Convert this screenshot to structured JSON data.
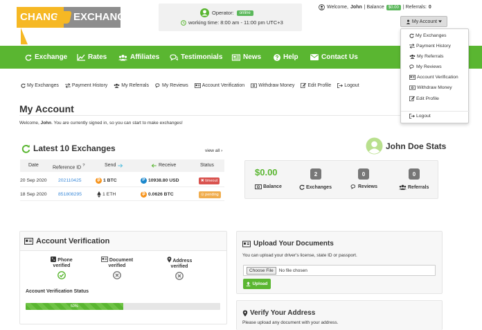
{
  "header": {
    "logo_left": "CHANGE",
    "logo_right": "EXCHANGE",
    "operator_label": "Operator:",
    "operator_status": "online",
    "working_time": "working time: 8:00 am - 11:00 pm UTC+3",
    "welcome_prefix": "Welcome,",
    "user_name": "John",
    "balance_label": "| Balance",
    "balance_value": "$0.00",
    "referrals_label": "| Referrals:",
    "referrals_value": "0",
    "account_button": "My Account"
  },
  "nav": {
    "items": [
      {
        "label": "Exchange",
        "icon": "refresh-icon"
      },
      {
        "label": "Rates",
        "icon": "chart-icon"
      },
      {
        "label": "Affiliates",
        "icon": "users-icon"
      },
      {
        "label": "Testimonials",
        "icon": "comments-icon"
      },
      {
        "label": "News",
        "icon": "newspaper-icon"
      },
      {
        "label": "Help",
        "icon": "question-icon"
      },
      {
        "label": "Contact Us",
        "icon": "envelope-icon"
      }
    ]
  },
  "subnav": {
    "items": [
      {
        "label": "My Exchanges",
        "icon": "refresh-icon"
      },
      {
        "label": "Payment History",
        "icon": "arrows-icon"
      },
      {
        "label": "My Referrals",
        "icon": "users-icon"
      },
      {
        "label": "My Reviews",
        "icon": "comments-icon"
      },
      {
        "label": "Account Verification",
        "icon": "id-card-icon"
      },
      {
        "label": "Withdraw Money",
        "icon": "money-icon"
      },
      {
        "label": "Edit Profile",
        "icon": "edit-icon"
      },
      {
        "label": "Logout",
        "icon": "logout-icon"
      }
    ]
  },
  "dropdown": {
    "items": [
      {
        "label": "My Exchanges",
        "icon": "refresh-icon"
      },
      {
        "label": "Payment History",
        "icon": "arrows-icon"
      },
      {
        "label": "My Referrals",
        "icon": "users-icon"
      },
      {
        "label": "My Reviews",
        "icon": "comments-icon"
      },
      {
        "label": "Account Verification",
        "icon": "id-card-icon"
      },
      {
        "label": "Withdraw Money",
        "icon": "money-icon"
      },
      {
        "label": "Edit Profile",
        "icon": "edit-icon"
      }
    ],
    "logout": "Logout"
  },
  "page": {
    "title": "My Account",
    "welcome_pre": "Welcome,",
    "welcome_name": "John",
    "welcome_post": ". You are currently signed in, so you can start to make exchanges!"
  },
  "exchanges": {
    "title": "Latest 10 Exchanges",
    "view_all": "view all ›",
    "columns": [
      "Date",
      "Reference ID",
      "Send",
      "Receive",
      "Status"
    ],
    "ref_sup": "?",
    "rows": [
      {
        "date": "20 Sep 2020",
        "ref": "202110425",
        "send": "1 BTC",
        "send_coin": "btc",
        "receive": "10938.80 USD",
        "receive_coin": "paypal",
        "status": "timeout",
        "status_color": "#d9534f"
      },
      {
        "date": "18 Sep 2020",
        "ref": "851808295",
        "send": "1 ETH",
        "send_coin": "eth",
        "receive": "0.0626 BTC",
        "receive_coin": "btc",
        "status": "pending",
        "status_color": "#f0ad4e"
      }
    ]
  },
  "stats": {
    "title": "John Doe Stats",
    "balance_value": "$0.00",
    "balance_label": "Balance",
    "exchanges_value": "2",
    "exchanges_label": "Exchanges",
    "reviews_value": "0",
    "reviews_label": "Reviews",
    "referrals_value": "0",
    "referrals_label": "Referrals"
  },
  "verification": {
    "title": "Account Verification",
    "phone_label": "Phone",
    "phone_status": "verified",
    "document_label": "Document",
    "document_status": "verified",
    "address_label": "Address",
    "address_status": "verified",
    "status_label": "Account Verification Status",
    "progress_text": "50%",
    "progress_percent": 50
  },
  "upload": {
    "title": "Upload Your Documents",
    "description": "You can upload your driver's license, state ID or passport.",
    "choose_file": "Choose File",
    "no_file": "No file chosen",
    "upload_button": "Upload"
  },
  "verify_address": {
    "title": "Verify Your Address",
    "description": "Please upload any document with your address."
  },
  "colors": {
    "green": "#5ab631",
    "orange": "#f6b824",
    "link": "#3b8ad9"
  }
}
